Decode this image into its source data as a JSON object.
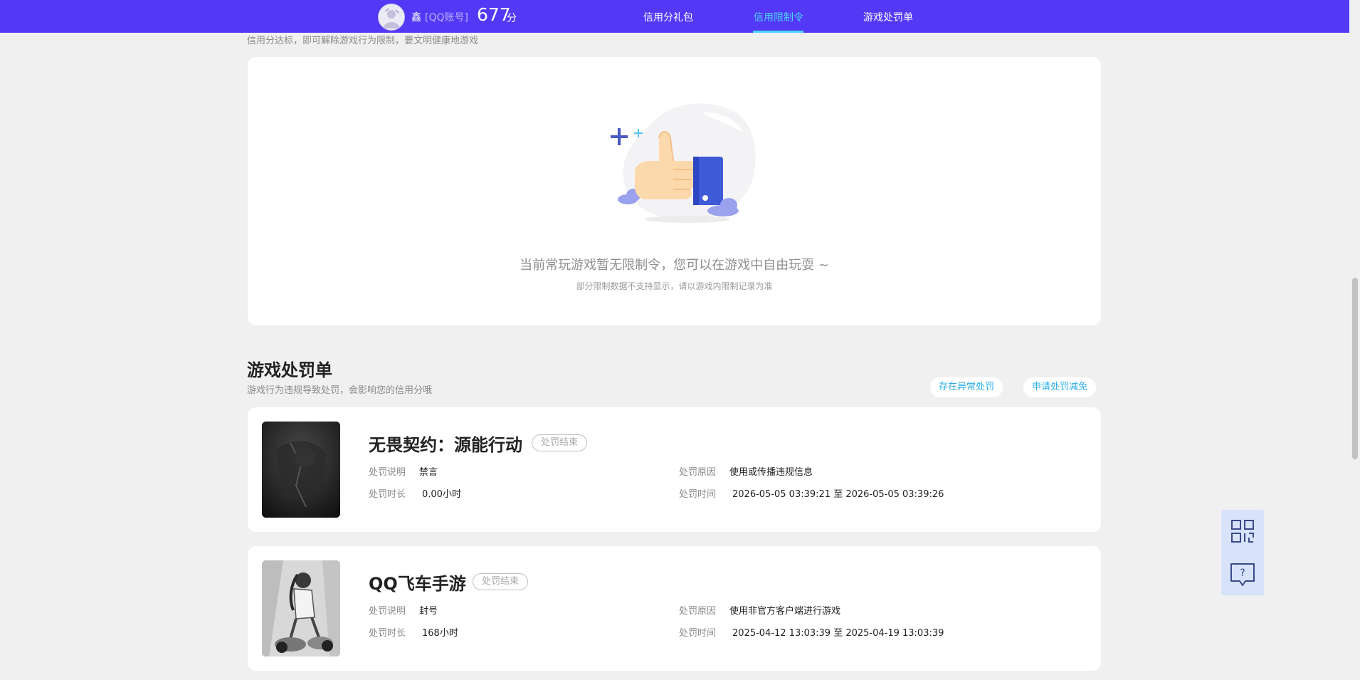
{
  "header": {
    "user_name": "鑫",
    "account_tag": "[QQ账号]",
    "score": "677",
    "score_unit": "分",
    "nav": [
      {
        "label": "信用分礼包"
      },
      {
        "label": "信用限制令",
        "active": true
      },
      {
        "label": "游戏处罚单"
      }
    ],
    "bg_color": "#5338f5",
    "active_color": "#4cd6ff"
  },
  "restriction": {
    "desc": "信用分达标，即可解除游戏行为限制，要文明健康地游戏",
    "empty_title": "当前常玩游戏暂无限制令，您可以在游戏中自由玩耍 ~",
    "empty_sub": "部分限制数据不支持显示，请以游戏内限制记录为准",
    "illustration": "thumbs-up-icon"
  },
  "penalty": {
    "title": "游戏处罚单",
    "desc": "游戏行为违规导致处罚，会影响您的信用分哦",
    "btn_abnormal": "存在异常处罚",
    "btn_appeal": "申请处罚减免",
    "labels": {
      "desc": "处罚说明",
      "duration": "处罚时长",
      "reason": "处罚原因",
      "time": "处罚时间"
    },
    "items": [
      {
        "game": "无畏契约：源能行动",
        "status": "处罚结束",
        "desc_value": "禁言",
        "duration_value": "0.00小时",
        "reason_value": "使用或传播违规信息",
        "time_value": "2026-05-05 03:39:21 至 2026-05-05 03:39:26"
      },
      {
        "game": "QQ飞车手游",
        "status": "处罚结束",
        "desc_value": "封号",
        "duration_value": "168小时",
        "reason_value": "使用非官方客户端进行游戏",
        "time_value": "2025-04-12 13:03:39 至 2025-04-19 13:03:39"
      }
    ]
  },
  "float": {
    "qr_icon": "qr-code-icon",
    "help_icon": "help-chat-icon"
  }
}
